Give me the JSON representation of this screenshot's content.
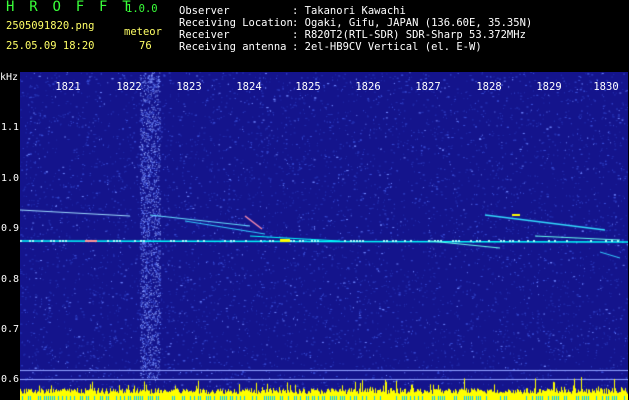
{
  "header": {
    "app_title": "H R O F F T",
    "version": "1.0.0",
    "filename": "2505091820.png",
    "detection_type": "meteor",
    "datetime": "25.05.09 18:20",
    "count": "76",
    "info": [
      {
        "label": "Observer",
        "value": ": Takanori Kawachi"
      },
      {
        "label": "Receiving Location",
        "value": ": Ogaki, Gifu, JAPAN (136.60E, 35.35N)"
      },
      {
        "label": "Receiver",
        "value": ": R820T2(RTL-SDR) SDR-Sharp 53.372MHz"
      },
      {
        "label": "Receiving antenna",
        "value": ": 2el-HB9CV Vertical (el. E-W)"
      }
    ]
  },
  "spectrogram": {
    "y_unit": "kHz",
    "y_ticks": [
      "1.1",
      "1.0",
      "0.9",
      "0.8",
      "0.7",
      "0.6"
    ],
    "x_ticks": [
      "1821",
      "1822",
      "1823",
      "1824",
      "1825",
      "1826",
      "1827",
      "1828",
      "1829",
      "1830"
    ],
    "colors": {
      "background": "#14148c",
      "noise": "#3a4fd8",
      "signal": "#00ffff",
      "signal_hot": "#ffff00",
      "bottom_bars": "#ffff00"
    }
  }
}
